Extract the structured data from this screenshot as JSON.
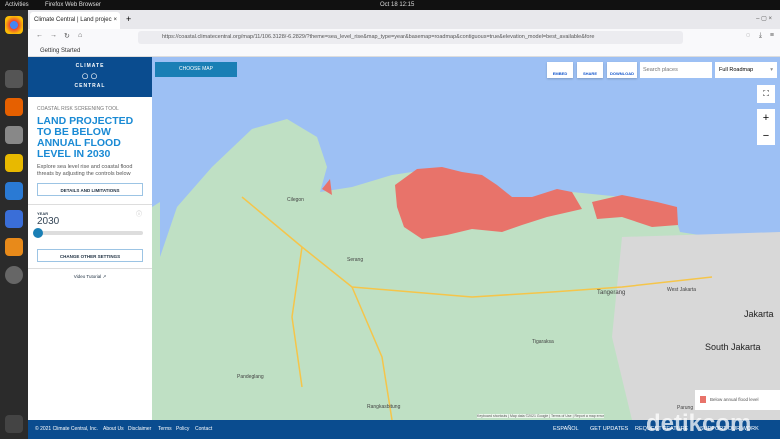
{
  "system": {
    "activities": "Activities",
    "app": "Firefox Web Browser",
    "clock": "Oct 18  12:15"
  },
  "browser": {
    "tab_title": "Climate Central | Land projec",
    "url": "https://coastal.climatecentral.org/map/11/106.3128/-6.2829/?theme=sea_level_rise&map_type=year&basemap=roadmap&contiguous=true&elevation_model=best_available&fore",
    "bookmark": "Getting Started"
  },
  "sidebar": {
    "logo_top": "CLIMATE",
    "logo_bottom": "CENTRAL",
    "tool": "COASTAL RISK SCREENING TOOL",
    "title": "LAND PROJECTED TO BE BELOW ANNUAL FLOOD LEVEL IN 2030",
    "desc": "Explore sea level rise and coastal flood threats by adjusting the controls below",
    "details": "DETAILS AND LIMITATIONS",
    "year_label": "YEAR",
    "year": "2030",
    "year_progress": 0,
    "change": "CHANGE OTHER SETTINGS",
    "video": "Video Tutorial"
  },
  "map": {
    "choose": "CHOOSE MAP",
    "embed": "EMBED",
    "share": "SHARE",
    "download": "DOWNLOAD",
    "search_placeholder": "Search places",
    "basemap": "Full Roadmap",
    "legend": "Below annual flood level",
    "flood_color": "#e8736a",
    "places": [
      "Cilegon",
      "Serang",
      "Tangerang",
      "West Jakarta",
      "Jakarta",
      "South Jakarta",
      "Pandeglang",
      "Rangkasbitung",
      "Tigaraksa",
      "Parung"
    ],
    "attribution": "Keyboard shortcuts | Map data ©2021 Google | Terms of Use | Report a map error"
  },
  "footer": {
    "copyright": "© 2021 Climate Central, Inc.",
    "links": [
      "About Us",
      "Disclaimer",
      "Terms",
      "Policy",
      "Contact"
    ],
    "right": [
      "ESPAÑOL",
      "GET UPDATES",
      "REQUEST FEATURE",
      "SUPPORT OUR WORK"
    ],
    "watermark": "detikcom"
  }
}
